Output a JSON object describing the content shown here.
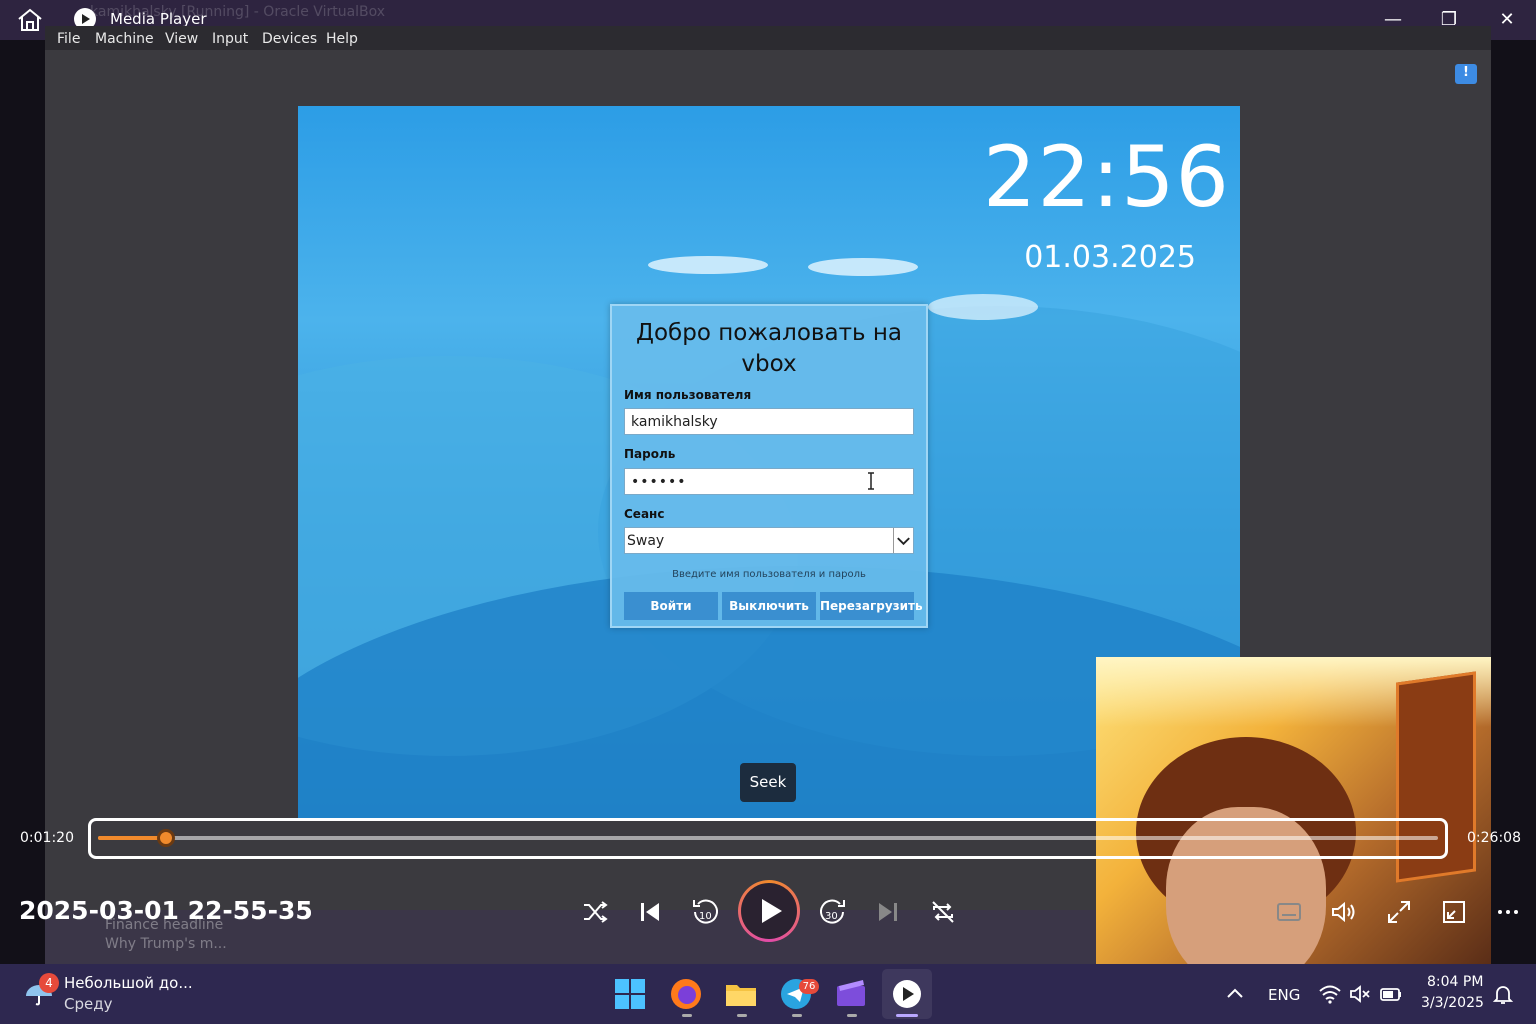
{
  "player": {
    "app_title": "Media Player",
    "behind_window_title": "kamikhalsky [Running] - Oracle VirtualBox",
    "filename": "2025-03-01 22-55-35",
    "time_current": "0:01:20",
    "time_total": "0:26:08",
    "progress_fraction": 0.051,
    "seek_tooltip": "Seek",
    "accent_color": "#f08a2c"
  },
  "vbox": {
    "menu": [
      "File",
      "Machine",
      "View",
      "Input",
      "Devices",
      "Help"
    ]
  },
  "guest": {
    "clock": "22:56",
    "date": "01.03.2025",
    "login": {
      "title": "Добро пожаловать на vbox",
      "username_label": "Имя пользователя",
      "username_value": "kamikhalsky",
      "password_label": "Пароль",
      "password_value": "••••••",
      "session_label": "Сеанс",
      "session_value": "Sway",
      "hint": "Введите имя пользователя и пароль",
      "buttons": [
        "Войти",
        "Выключить",
        "Перезагрузить"
      ]
    }
  },
  "recorded_taskbar": {
    "news_title": "Finance headline",
    "news_text": "Why Trump's m..."
  },
  "taskbar": {
    "weather_badge": "4",
    "weather_title": "Небольшой до...",
    "weather_sub": "Среду",
    "telegram_badge": "76",
    "lang": "ENG",
    "time": "8:04 PM",
    "date": "3/3/2025"
  }
}
